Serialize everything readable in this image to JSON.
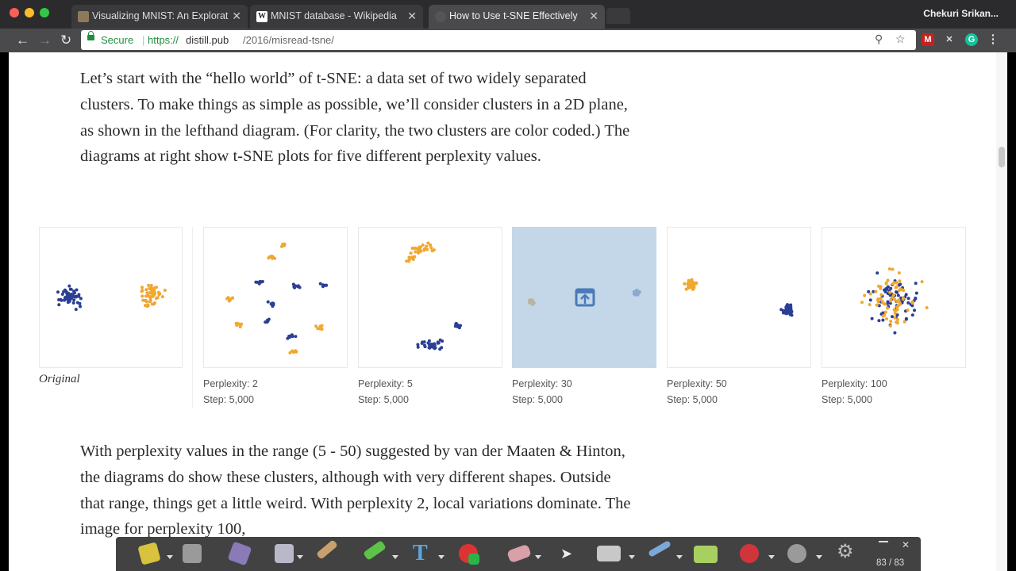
{
  "browser": {
    "tabs": [
      {
        "title": "Visualizing MNIST: An Explorat",
        "favicon": "mnist-favicon-icon"
      },
      {
        "title": "MNIST database - Wikipedia",
        "favicon": "W"
      },
      {
        "title": "How to Use t-SNE Effectively",
        "favicon": "distill-favicon-icon"
      }
    ],
    "user": "Chekuri Srikan...",
    "secure_label": "Secure",
    "url_prefix": "https://",
    "url_host": "distill.pub",
    "url_path": "/2016/misread-tsne/"
  },
  "article": {
    "intro": "Let’s start with the “hello world” of t-SNE: a data set of two widely separated clusters. To make things as simple as possible, we’ll consider clusters in a 2D plane, as shown in the lefthand diagram. (For clarity, the two clusters are color coded.) The diagrams at right show t-SNE plots for five different perplexity values.",
    "outro": "With perplexity values in the range (5 - 50) suggested by van der Maaten & Hinton, the diagrams do show these clusters, although with very different shapes. Outside that range, things get a little weird. With perplexity 2, local variations dominate. The image for perplexity 100,"
  },
  "figures": {
    "original_caption": "Original",
    "plots": [
      {
        "perplexity_label": "Perplexity: 2",
        "step_label": "Step: 5,000"
      },
      {
        "perplexity_label": "Perplexity: 5",
        "step_label": "Step: 5,000"
      },
      {
        "perplexity_label": "Perplexity: 30",
        "step_label": "Step: 5,000"
      },
      {
        "perplexity_label": "Perplexity: 50",
        "step_label": "Step: 5,000"
      },
      {
        "perplexity_label": "Perplexity: 100",
        "step_label": "Step: 5,000"
      }
    ]
  },
  "colors": {
    "blue_cluster": "#2b3f94",
    "orange_cluster": "#f0a830",
    "hover_overlay": "#c3d7e8"
  },
  "taskbar": {
    "page_count": "83 / 83"
  }
}
